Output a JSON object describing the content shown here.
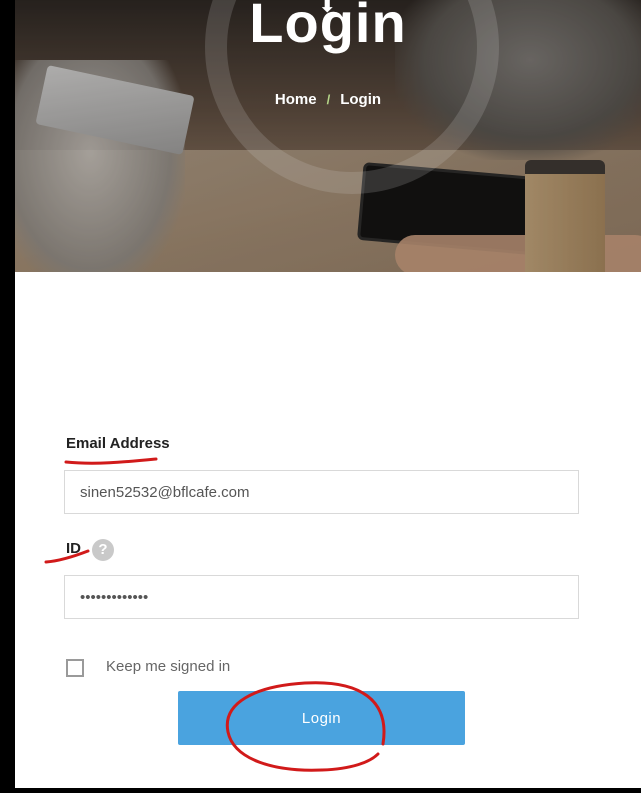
{
  "hero": {
    "title": "Login",
    "breadcrumb": {
      "home": "Home",
      "separator": "/",
      "current": "Login"
    }
  },
  "form": {
    "email_label": "Email Address",
    "email_value": "sinen52532@bflcafe.com",
    "id_label": "ID",
    "id_help_icon": "?",
    "id_value": "•••••••••••••",
    "keep_signed_in_label": "Keep me signed in",
    "keep_signed_in_checked": false,
    "login_button": "Login"
  },
  "colors": {
    "button": "#4aa3df",
    "annotation_ink": "#d11a1a",
    "breadcrumb_separator": "#b7d88a"
  }
}
